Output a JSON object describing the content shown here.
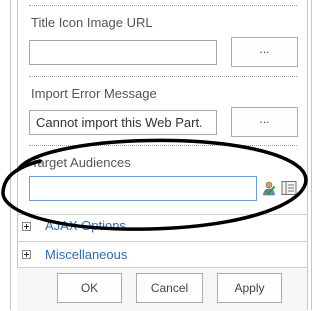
{
  "fields": {
    "title_icon_url": {
      "label": "Title Icon Image URL",
      "value": ""
    },
    "import_error": {
      "label": "Import Error Message",
      "value": "Cannot import this Web Part."
    },
    "target_audiences": {
      "label": "Target Audiences",
      "value": ""
    }
  },
  "ellipsis_label": "...",
  "sections": [
    {
      "label": "AJAX Options"
    },
    {
      "label": "Miscellaneous"
    }
  ],
  "buttons": {
    "ok": "OK",
    "cancel": "Cancel",
    "apply": "Apply"
  },
  "icons": {
    "people_picker": "check-names-icon",
    "browse": "address-book-icon"
  },
  "colors": {
    "section_link": "#2b6fb5",
    "annotation_ellipse": "#000000",
    "field_focus_border": "#6c9fd1"
  }
}
